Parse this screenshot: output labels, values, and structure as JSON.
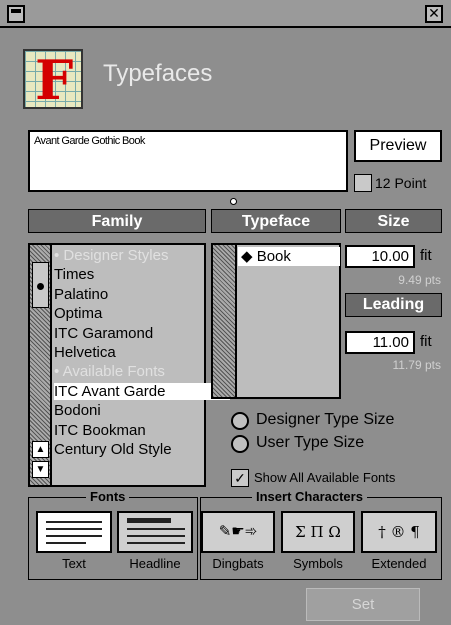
{
  "window": {
    "menu_icon": "window-menu-icon",
    "close_icon": "close-icon",
    "close_glyph": "✕"
  },
  "app": {
    "title": "Typefaces",
    "icon_letter": "F",
    "icon": "typefaces-app-icon"
  },
  "preview": {
    "sample_text": "Avant Garde Gothic Book",
    "button_label": "Preview",
    "point_label": "12 Point",
    "point_checked": false
  },
  "headers": {
    "family": "Family",
    "typeface": "Typeface",
    "size": "Size",
    "leading": "Leading"
  },
  "family_list": {
    "items": [
      {
        "label": "• Designer Styles",
        "style": "dim"
      },
      {
        "label": "Times",
        "style": "normal"
      },
      {
        "label": "Palatino",
        "style": "normal"
      },
      {
        "label": "Optima",
        "style": "normal"
      },
      {
        "label": "ITC Garamond",
        "style": "normal"
      },
      {
        "label": "Helvetica",
        "style": "normal"
      },
      {
        "label": "• Available Fonts",
        "style": "dim"
      },
      {
        "label": "ITC Avant Garde",
        "style": "selected"
      },
      {
        "label": "Bodoni",
        "style": "normal"
      },
      {
        "label": "ITC Bookman",
        "style": "normal"
      },
      {
        "label": "Century Old Style",
        "style": "normal"
      }
    ]
  },
  "typeface_list": {
    "selected": "◆ Book"
  },
  "size": {
    "value": "10.00",
    "unit": "fit",
    "pts": "9.49 pts"
  },
  "leading": {
    "value": "11.00",
    "unit": "fit",
    "pts": "11.79 pts"
  },
  "type_size_options": {
    "designer": "Designer Type Size",
    "user": "User Type Size"
  },
  "show_all": {
    "label": "Show All Available Fonts",
    "checked": true
  },
  "fonts_group": {
    "title": "Fonts",
    "buttons": [
      {
        "label": "Text",
        "icon": "text-lines-icon"
      },
      {
        "label": "Headline",
        "icon": "headline-lines-icon"
      }
    ]
  },
  "chars_group": {
    "title": "Insert Characters",
    "buttons": [
      {
        "label": "Dingbats",
        "glyphs": "✎☛➾",
        "icon": "dingbats-icon"
      },
      {
        "label": "Symbols",
        "glyphs": "Σ Π Ω",
        "icon": "symbols-icon"
      },
      {
        "label": "Extended",
        "glyphs": "† ® ¶",
        "icon": "extended-icon"
      }
    ]
  },
  "set_button": {
    "label": "Set",
    "enabled": false
  },
  "colors": {
    "window_bg": "#8e8e8e",
    "header_bg": "#6a6a6a",
    "field_bg": "#ffffff",
    "accent_red": "#d40000"
  }
}
